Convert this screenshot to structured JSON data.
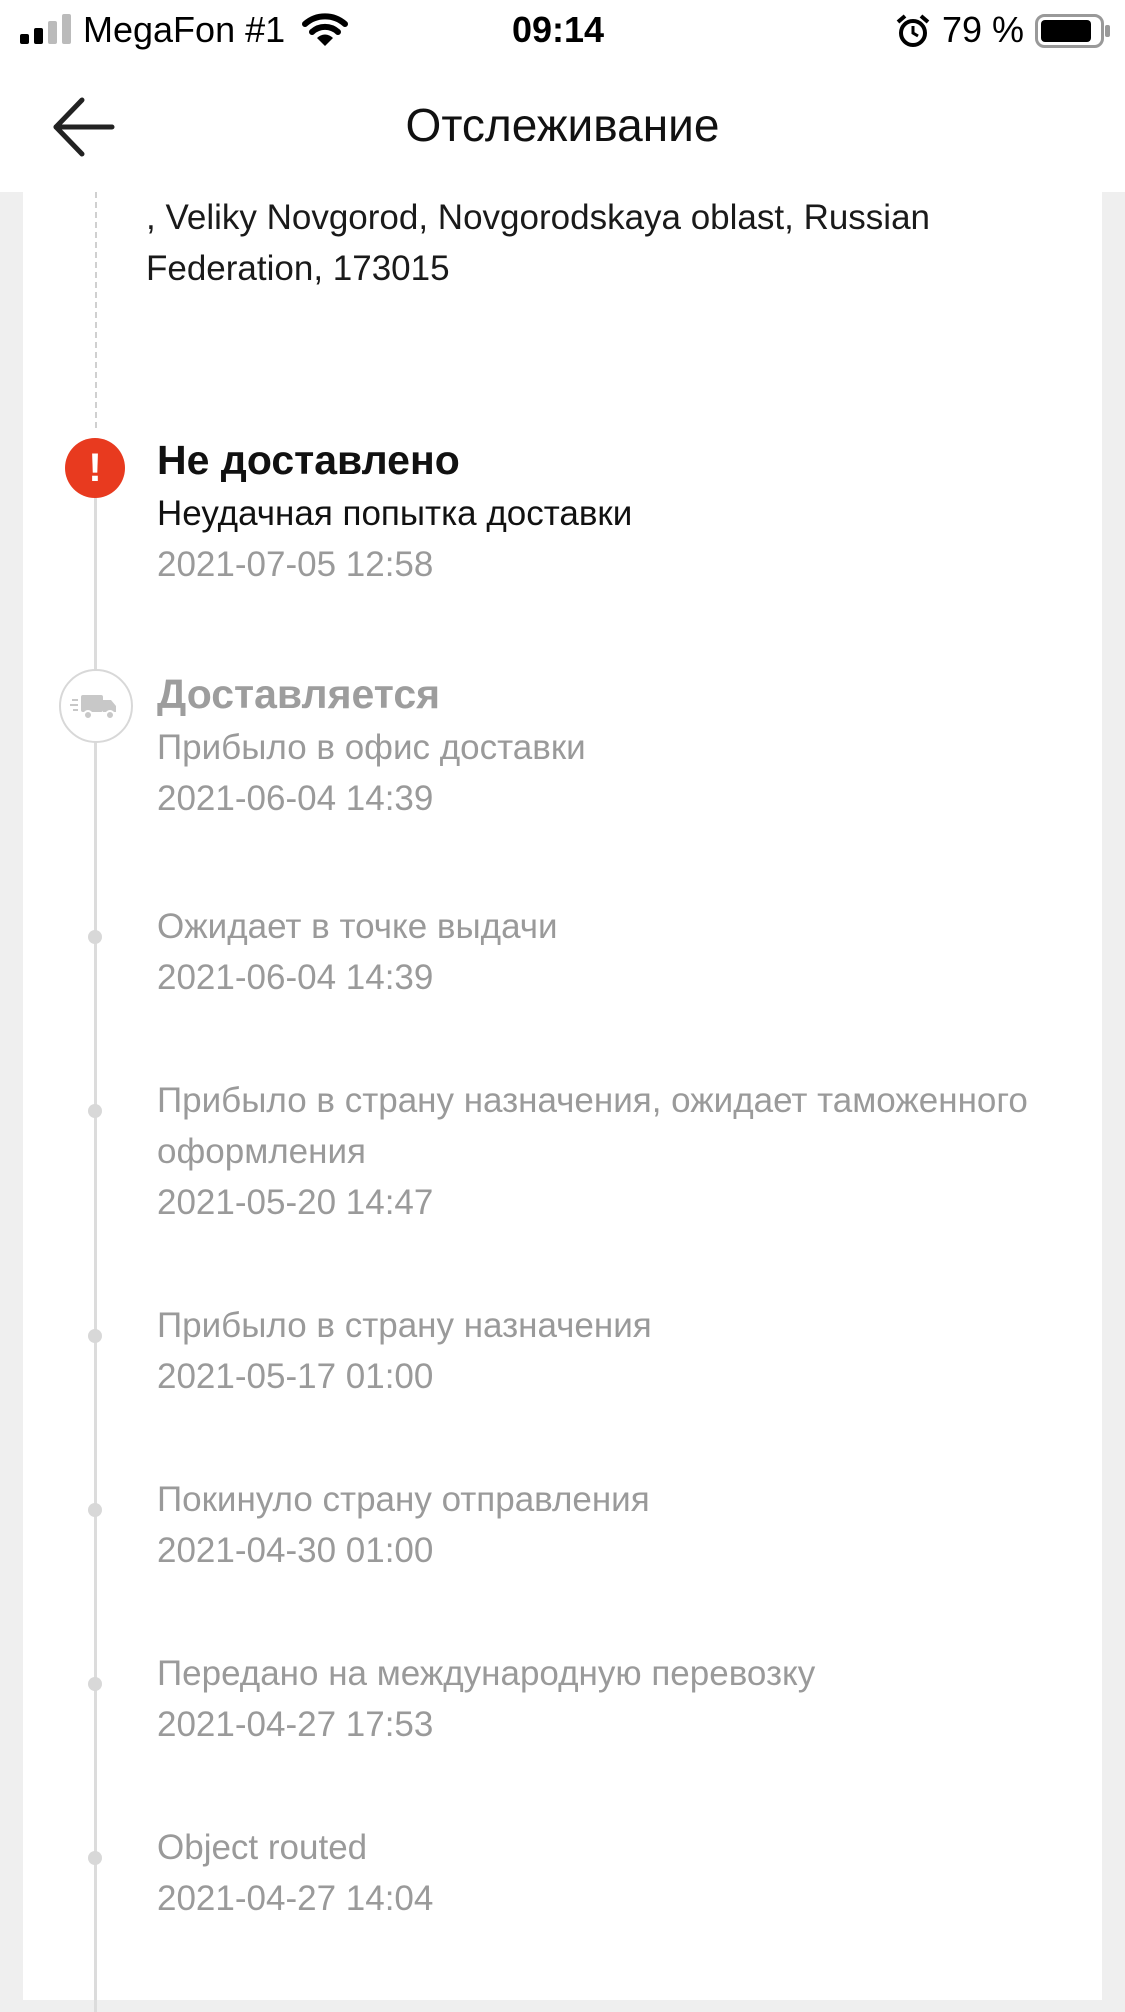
{
  "status_bar": {
    "carrier": "MegaFon #1",
    "time": "09:14",
    "battery_percent": "79 %"
  },
  "header": {
    "title": "Отслеживание"
  },
  "address": ", Veliky Novgorod,  Novgorodskaya oblast,  Russian Federation,  173015",
  "events": [
    {
      "title": "Не доставлено",
      "description": "Неудачная попытка доставки",
      "time": "2021-07-05 12:58"
    },
    {
      "title": "Доставляется",
      "description": "Прибыло в офис доставки",
      "time": "2021-06-04 14:39"
    },
    {
      "description": "Ожидает в точке выдачи",
      "time": "2021-06-04 14:39"
    },
    {
      "description": "Прибыло в страну назначения, ожидает таможенного оформления",
      "time": "2021-05-20 14:47"
    },
    {
      "description": "Прибыло в страну назначения",
      "time": "2021-05-17 01:00"
    },
    {
      "description": "Покинуло страну отправления",
      "time": "2021-04-30 01:00"
    },
    {
      "description": "Передано на международную перевозку",
      "time": "2021-04-27 17:53"
    },
    {
      "description": "Object routed",
      "time": "2021-04-27 14:04"
    }
  ],
  "colors": {
    "alert": "#e83a1f",
    "muted_text": "#9a9a9a",
    "background": "#efefef"
  }
}
